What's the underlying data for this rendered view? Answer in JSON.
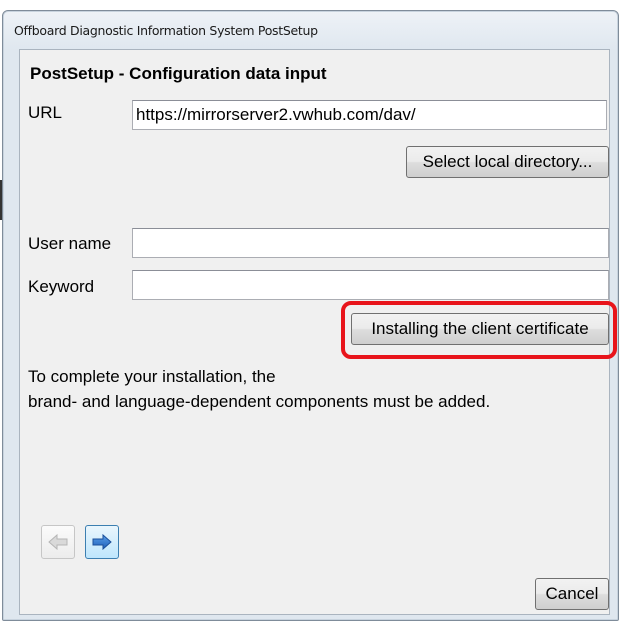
{
  "window": {
    "title": "Offboard Diagnostic Information System PostSetup"
  },
  "heading": "PostSetup - Configuration data input",
  "url": {
    "label": "URL",
    "value": "https://mirrorserver2.vwhub.com/dav/"
  },
  "select_directory_button": "Select local directory...",
  "username": {
    "label": "User name",
    "value": ""
  },
  "keyword": {
    "label": "Keyword",
    "value": ""
  },
  "certificate_button": "Installing the client certificate",
  "message": {
    "line1": "To complete your installation, the",
    "line2": "brand- and language-dependent components must be added."
  },
  "nav": {
    "back_icon": "arrow-left-icon",
    "next_icon": "arrow-right-icon"
  },
  "cancel_button": "Cancel",
  "colors": {
    "highlight": "#e8141b",
    "next_arrow": "#2a6fc9"
  }
}
